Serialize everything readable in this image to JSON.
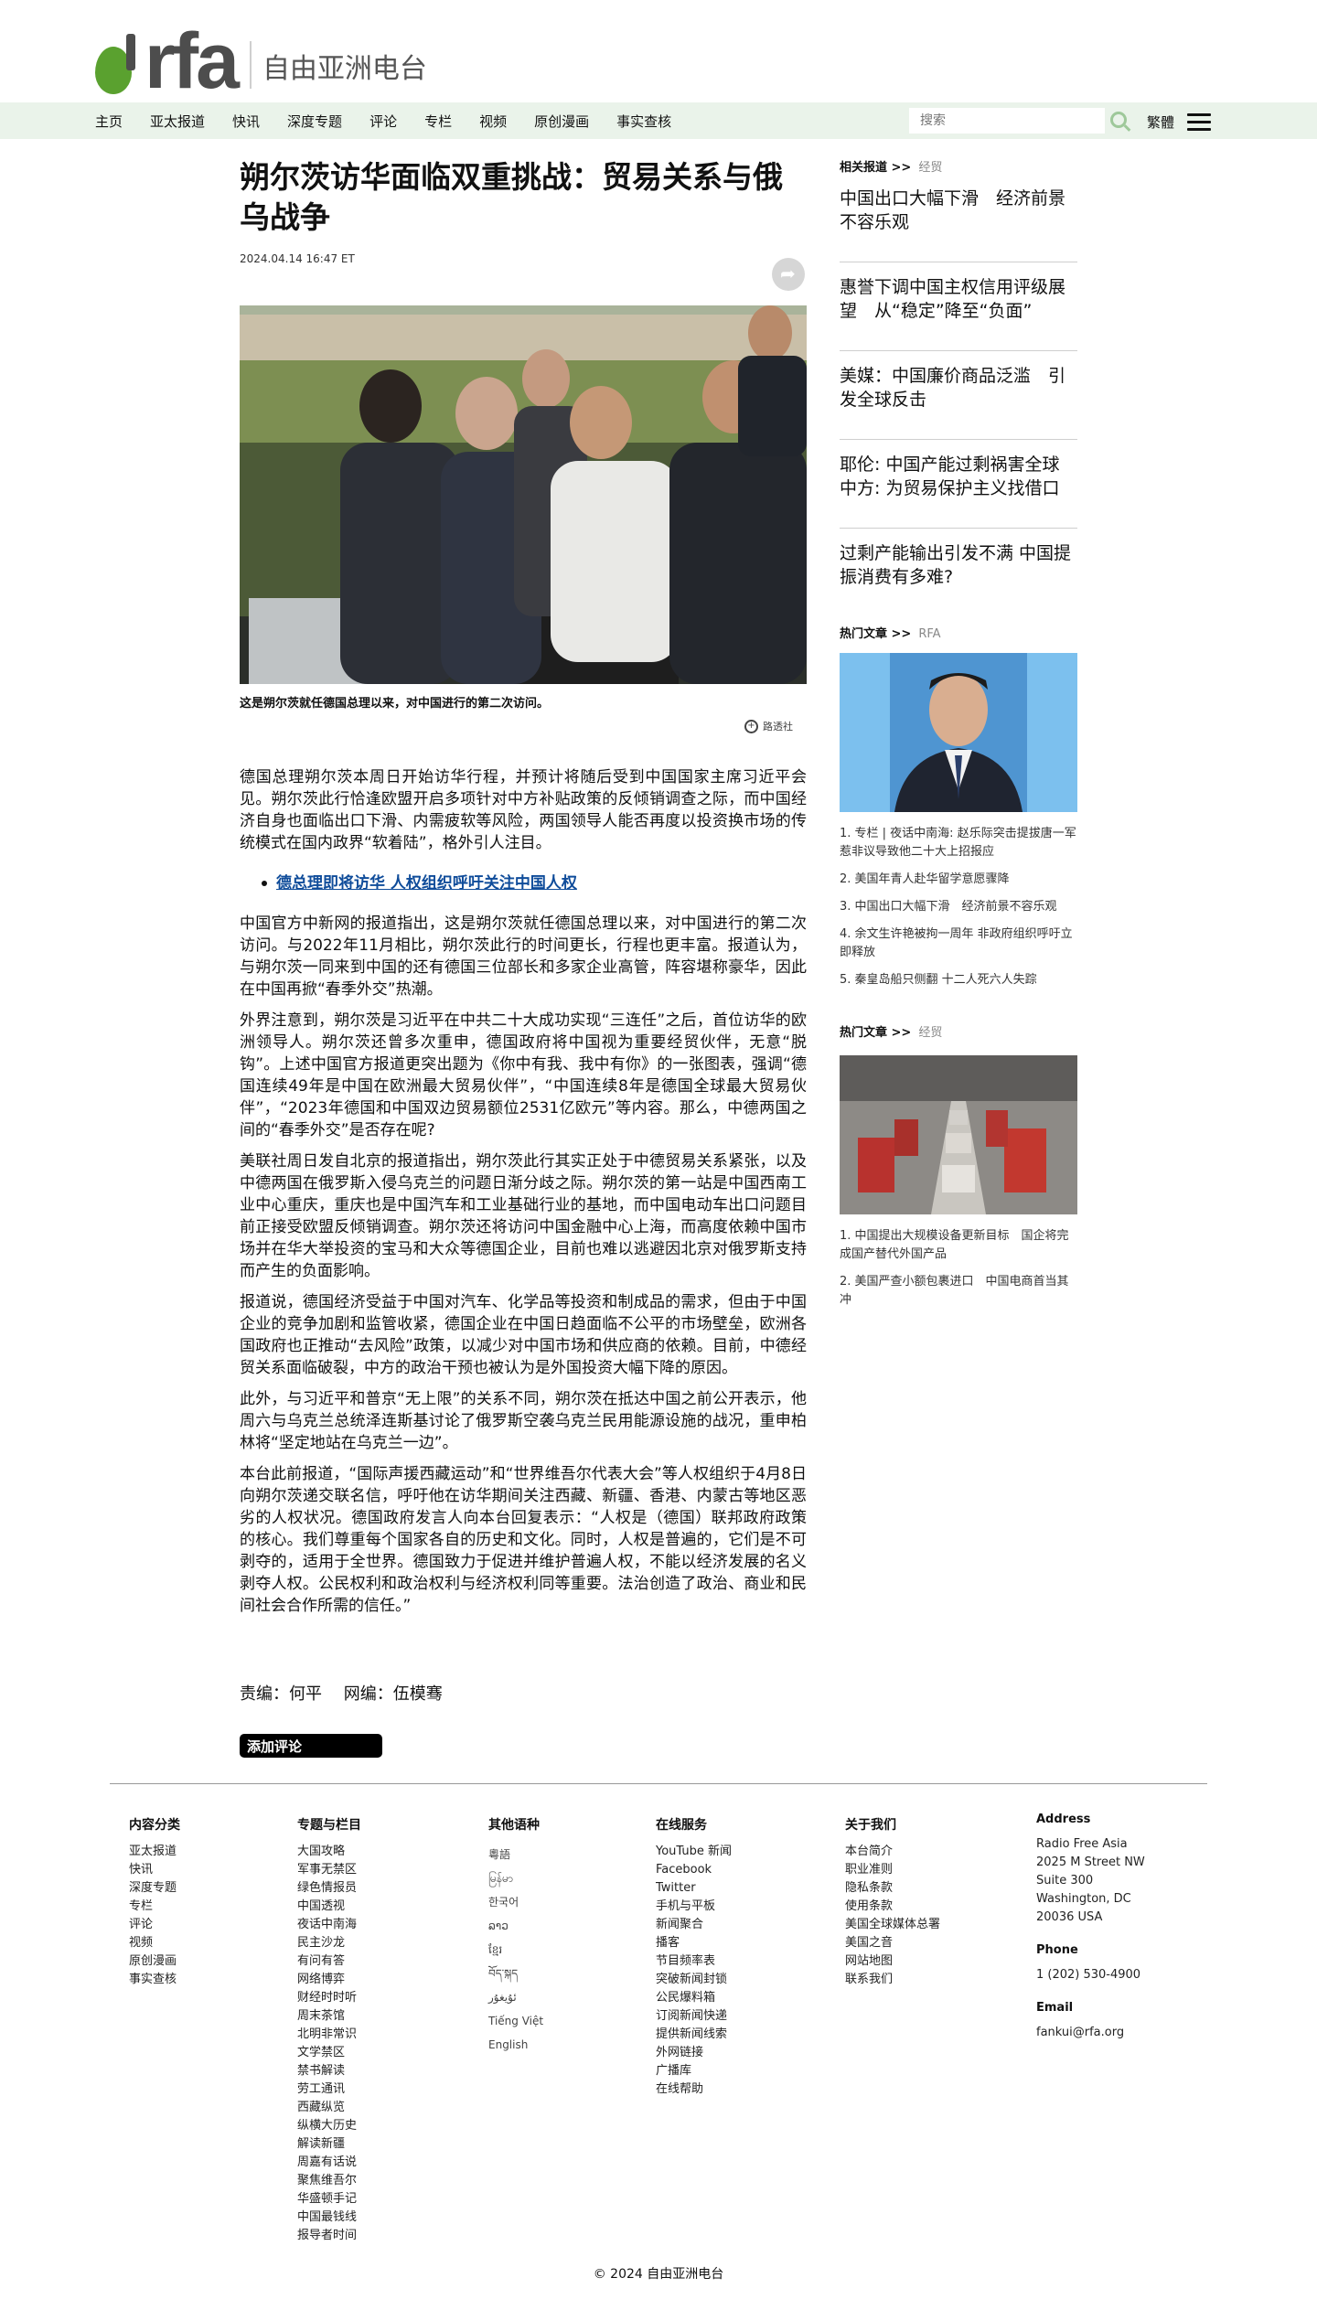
{
  "header": {
    "logo_text": "rfa",
    "logo_cn": "自由亚洲电台",
    "nav": [
      "主页",
      "亚太报道",
      "快讯",
      "深度专题",
      "评论",
      "专栏",
      "视频",
      "原创漫画",
      "事实查核"
    ],
    "search_placeholder": "搜索",
    "lang_label": "繁體"
  },
  "article": {
    "title": "朔尔茨访华面临双重挑战：贸易关系与俄乌战争",
    "date": "2024.04.14 16:47 ET",
    "caption": "这是朔尔茨就任德国总理以来，对中国进行的第二次访问。",
    "enlarge_label": "路透社",
    "paragraphs_before": [
      "德国总理朔尔茨本周日开始访华行程，并预计将随后受到中国国家主席习近平会见。朔尔茨此行恰逢欧盟开启多项针对中方补贴政策的反倾销调查之际，而中国经济自身也面临出口下滑、内需疲软等风险，两国领导人能否再度以投资换市场的传统模式在国内政界“软着陆”，格外引人注目。"
    ],
    "related_link": "德总理即将访华 人权组织呼吁关注中国人权",
    "paragraphs_after": [
      "中国官方中新网的报道指出，这是朔尔茨就任德国总理以来，对中国进行的第二次访问。与2022年11月相比，朔尔茨此行的时间更长，行程也更丰富。报道认为，与朔尔茨一同来到中国的还有德国三位部长和多家企业高管，阵容堪称豪华，因此在中国再掀“春季外交”热潮。",
      "外界注意到，朔尔茨是习近平在中共二十大成功实现“三连任”之后，首位访华的欧洲领导人。朔尔茨还曾多次重申，德国政府将中国视为重要经贸伙伴，无意“脱钩”。上述中国官方报道更突出题为《你中有我、我中有你》的一张图表，强调“德国连续49年是中国在欧洲最大贸易伙伴”，“中国连续8年是德国全球最大贸易伙伴”，“2023年德国和中国双边贸易额位2531亿欧元”等内容。那么，中德两国之间的“春季外交”是否存在呢?",
      "美联社周日发自北京的报道指出，朔尔茨此行其实正处于中德贸易关系紧张，以及中德两国在俄罗斯入侵乌克兰的问题日渐分歧之际。朔尔茨的第一站是中国西南工业中心重庆，重庆也是中国汽车和工业基础行业的基地，而中国电动车出口问题目前正接受欧盟反倾销调查。朔尔茨还将访问中国金融中心上海，而高度依赖中国市场并在华大举投资的宝马和大众等德国企业，目前也难以逃避因北京对俄罗斯支持而产生的负面影响。",
      "报道说，德国经济受益于中国对汽车、化学品等投资和制成品的需求，但由于中国企业的竞争加剧和监管收紧，德国企业在中国日趋面临不公平的市场壁垒，欧洲各国政府也正推动“去风险”政策，以减少对中国市场和供应商的依赖。目前，中德经贸关系面临破裂，中方的政治干预也被认为是外国投资大幅下降的原因。",
      "此外，与习近平和普京“无上限”的关系不同，朔尔茨在抵达中国之前公开表示，他周六与乌克兰总统泽连斯基讨论了俄罗斯空袭乌克兰民用能源设施的战况，重申柏林将“坚定地站在乌克兰一边”。",
      "本台此前报道，“国际声援西藏运动”和“世界维吾尔代表大会”等人权组织于4月8日向朔尔茨递交联名信，呼吁他在访华期间关注西藏、新疆、香港、内蒙古等地区恶劣的人权状况。德国政府发言人向本台回复表示：“人权是（德国）联邦政府政策的核心。我们尊重每个国家各自的历史和文化。同时，人权是普遍的，它们是不可剥夺的，适用于全世界。德国致力于促进并维护普遍人权，不能以经济发展的名义剥夺人权。公民权利和政治权利与经济权利同等重要。法治创造了政治、商业和民间社会合作所需的信任。”"
    ],
    "editors": "责编：何平　 网编：伍模骞",
    "comment_button": "添加评论"
  },
  "sidebar": {
    "related_head": "相关报道 >>",
    "related_sub": "经贸",
    "related": [
      "中国出口大幅下滑　经济前景不容乐观",
      "惠誉下调中国主权信用评级展望　从“稳定”降至“负面”",
      "美媒：中国廉价商品泛滥　引发全球反击",
      "耶伦: 中国产能过剩祸害全球 中方: 为贸易保护主义找借口",
      "过剩产能输出引发不满 中国提振消费有多难?"
    ],
    "hot1_head": "热门文章 >>",
    "hot1_sub": "RFA",
    "hot1": [
      "1. 专栏 | 夜话中南海: 赵乐际突击提拔唐一军惹非议导致他二十大上招报应",
      "2. 美国年青人赴华留学意愿骤降",
      "3. 中国出口大幅下滑　经济前景不容乐观",
      "4. 余文生许艳被拘一周年 非政府组织呼吁立即释放",
      "5. 秦皇岛船只侧翻 十二人死六人失踪"
    ],
    "hot2_head": "热门文章 >>",
    "hot2_sub": "经贸",
    "hot2": [
      "1. 中国提出大规模设备更新目标　国企将完成国产替代外国产品",
      "2. 美国严查小额包裹进口　中国电商首当其冲"
    ]
  },
  "footer": {
    "col1": {
      "title": "内容分类",
      "items": [
        "亚太报道",
        "快讯",
        "深度专题",
        "专栏",
        "评论",
        "视频",
        "原创漫画",
        "事实查核"
      ]
    },
    "col2": {
      "title": "专题与栏目",
      "items": [
        "大国攻略",
        "军事无禁区",
        "绿色情报员",
        "中国透视",
        "夜话中南海",
        "民主沙龙",
        "有问有答",
        "网络博弈",
        "财经时时听",
        "周末茶馆",
        "北明非常识",
        "文学禁区",
        "禁书解读",
        "劳工通讯",
        "西藏纵览",
        "纵横大历史",
        "解读新疆",
        "周嘉有话说",
        "聚焦维吾尔",
        "华盛顿手记",
        "中国最钱线",
        "报导者时间"
      ]
    },
    "col3": {
      "title": "其他语种",
      "items": [
        "粵語",
        "မြန်မာ",
        "한국어",
        "ລາວ",
        "ខ្មែរ",
        "བོད་སྐད",
        "ئۇيغۇر",
        "Tiếng Việt",
        "English"
      ]
    },
    "col4": {
      "title": "在线服务",
      "items": [
        "YouTube 新闻",
        "Facebook",
        "Twitter",
        "手机与平板",
        "新闻聚合",
        "播客",
        "节目频率表",
        "突破新闻封锁",
        "公民爆料箱",
        "订阅新闻快递",
        "提供新闻线索",
        "外网链接",
        "广播库",
        "在线帮助"
      ]
    },
    "col5": {
      "title": "关于我们",
      "items": [
        "本台简介",
        "职业准则",
        "隐私条款",
        "使用条款",
        "美国全球媒体总署",
        "美国之音",
        "网站地图",
        "联系我们"
      ]
    },
    "address": {
      "title": "Address",
      "lines": [
        "Radio Free Asia",
        "2025 M Street NW",
        "Suite 300",
        "Washington, DC",
        "20036 USA"
      ],
      "phone_title": "Phone",
      "phone": "1 (202) 530-4900",
      "email_title": "Email",
      "email": "fankui@rfa.org"
    },
    "copyright": "© 2024 自由亚洲电台"
  }
}
